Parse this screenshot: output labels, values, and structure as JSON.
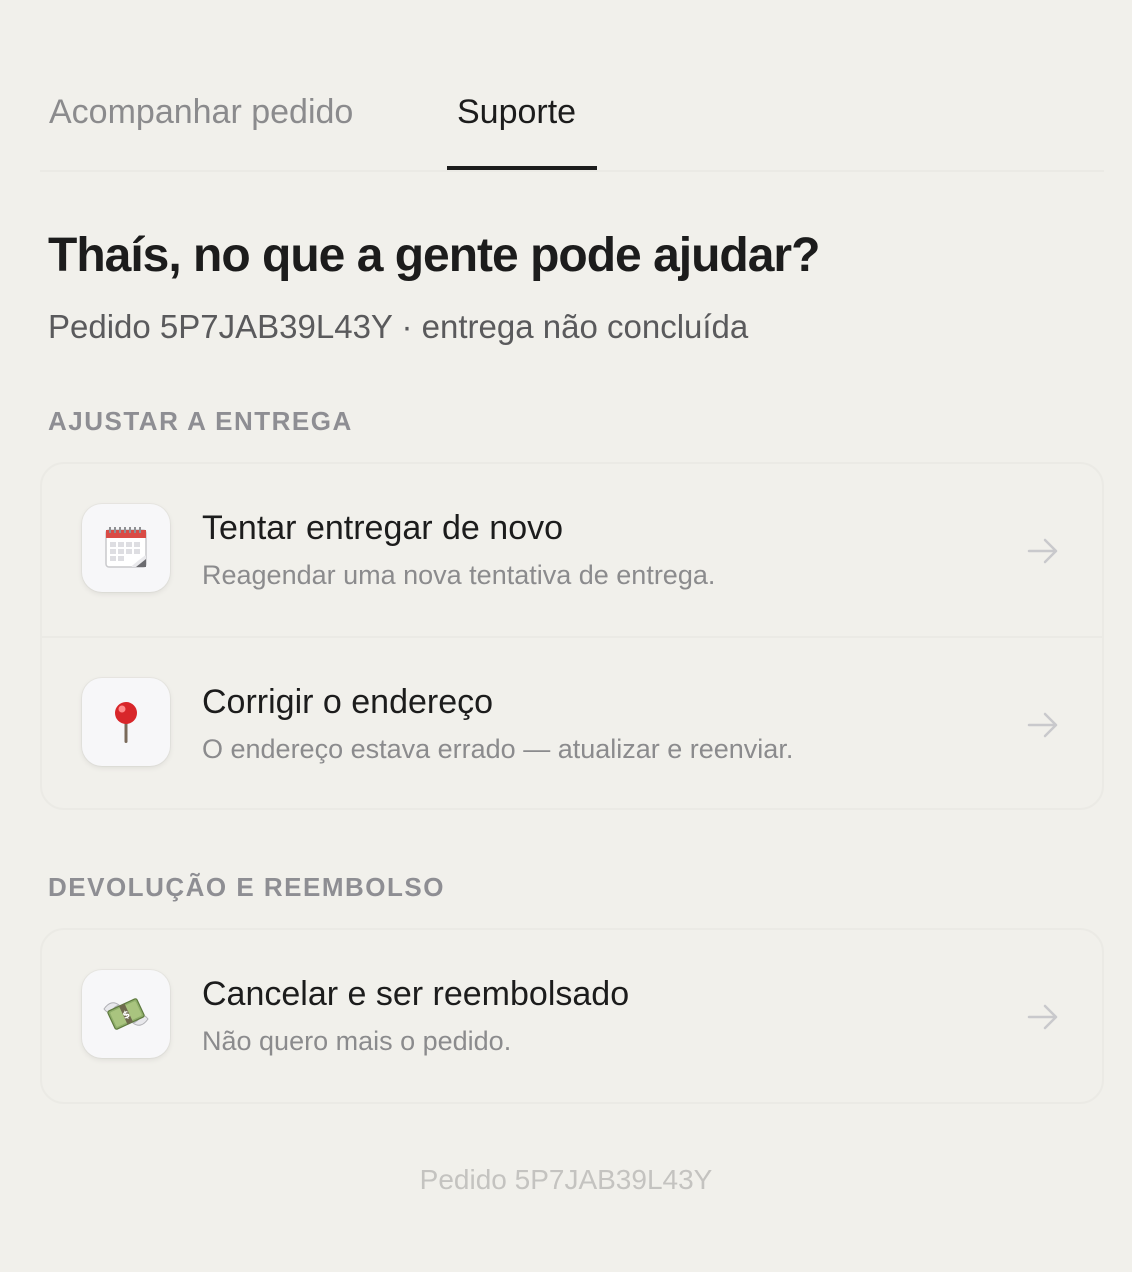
{
  "tabs": [
    {
      "label": "Acompanhar pedido",
      "active": false
    },
    {
      "label": "Suporte",
      "active": true
    }
  ],
  "header": {
    "title": "Thaís, no que a gente pode ajudar?",
    "subtitle": "Pedido 5P7JAB39L43Y · entrega não concluída"
  },
  "sections": [
    {
      "label": "AJUSTAR A ENTREGA",
      "items": [
        {
          "icon": "calendar-icon",
          "title": "Tentar entregar de novo",
          "description": "Reagendar uma nova tentativa de entrega."
        },
        {
          "icon": "pushpin-icon",
          "title": "Corrigir o endereço",
          "description": "O endereço estava errado — atualizar e reenviar."
        }
      ]
    },
    {
      "label": "DEVOLUÇÃO E REEMBOLSO",
      "items": [
        {
          "icon": "money-wings-icon",
          "title": "Cancelar e ser reembolsado",
          "description": "Não quero mais o pedido."
        }
      ]
    }
  ],
  "footer": {
    "text": "Pedido 5P7JAB39L43Y"
  },
  "colors": {
    "background": "#f1f0eb",
    "text": "#1c1c1c",
    "muted": "#8b8b8d"
  }
}
